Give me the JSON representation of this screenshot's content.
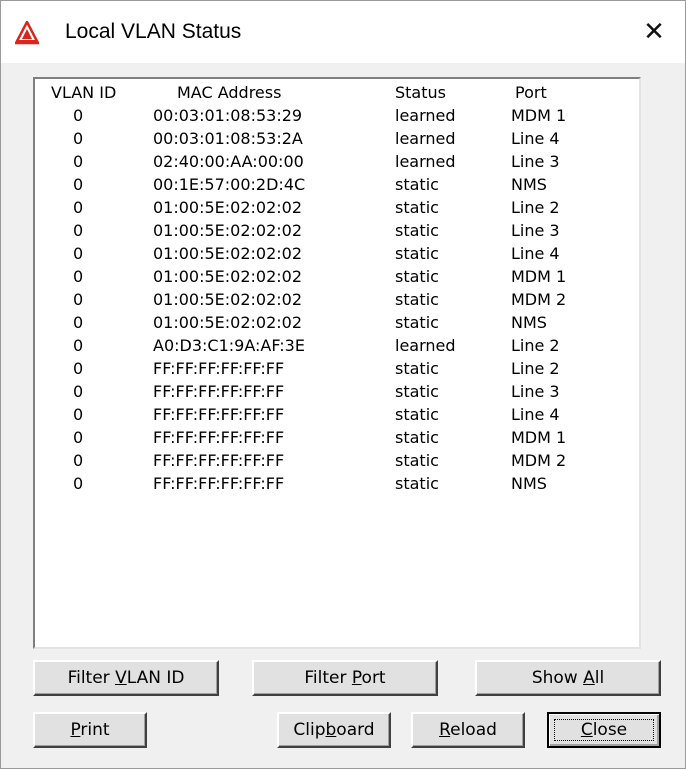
{
  "window": {
    "title": "Local VLAN Status",
    "close_glyph": "✕"
  },
  "table": {
    "headers": {
      "vlan_id": "VLAN ID",
      "mac": "MAC Address",
      "status": "Status",
      "port": "Port"
    },
    "rows": [
      {
        "vlan_id": "0",
        "mac": "00:03:01:08:53:29",
        "status": "learned",
        "port": "MDM 1"
      },
      {
        "vlan_id": "0",
        "mac": "00:03:01:08:53:2A",
        "status": "learned",
        "port": "Line 4"
      },
      {
        "vlan_id": "0",
        "mac": "02:40:00:AA:00:00",
        "status": "learned",
        "port": "Line 3"
      },
      {
        "vlan_id": "0",
        "mac": "00:1E:57:00:2D:4C",
        "status": "static",
        "port": "NMS"
      },
      {
        "vlan_id": "0",
        "mac": "01:00:5E:02:02:02",
        "status": "static",
        "port": "Line 2"
      },
      {
        "vlan_id": "0",
        "mac": "01:00:5E:02:02:02",
        "status": "static",
        "port": "Line 3"
      },
      {
        "vlan_id": "0",
        "mac": "01:00:5E:02:02:02",
        "status": "static",
        "port": "Line 4"
      },
      {
        "vlan_id": "0",
        "mac": "01:00:5E:02:02:02",
        "status": "static",
        "port": "MDM 1"
      },
      {
        "vlan_id": "0",
        "mac": "01:00:5E:02:02:02",
        "status": "static",
        "port": "MDM 2"
      },
      {
        "vlan_id": "0",
        "mac": "01:00:5E:02:02:02",
        "status": "static",
        "port": "NMS"
      },
      {
        "vlan_id": "0",
        "mac": "A0:D3:C1:9A:AF:3E",
        "status": "learned",
        "port": "Line 2"
      },
      {
        "vlan_id": "0",
        "mac": "FF:FF:FF:FF:FF:FF",
        "status": "static",
        "port": "Line 2"
      },
      {
        "vlan_id": "0",
        "mac": "FF:FF:FF:FF:FF:FF",
        "status": "static",
        "port": "Line 3"
      },
      {
        "vlan_id": "0",
        "mac": "FF:FF:FF:FF:FF:FF",
        "status": "static",
        "port": "Line 4"
      },
      {
        "vlan_id": "0",
        "mac": "FF:FF:FF:FF:FF:FF",
        "status": "static",
        "port": "MDM 1"
      },
      {
        "vlan_id": "0",
        "mac": "FF:FF:FF:FF:FF:FF",
        "status": "static",
        "port": "MDM 2"
      },
      {
        "vlan_id": "0",
        "mac": "FF:FF:FF:FF:FF:FF",
        "status": "static",
        "port": "NMS"
      }
    ]
  },
  "buttons": {
    "filter_vlan": {
      "pre": "Filter ",
      "mn": "V",
      "post": "LAN ID"
    },
    "filter_port": {
      "pre": "Filter ",
      "mn": "P",
      "post": "ort"
    },
    "show_all": {
      "pre": "Show ",
      "mn": "A",
      "post": "ll"
    },
    "print": {
      "pre": "",
      "mn": "P",
      "post": "rint"
    },
    "clipboard": {
      "pre": "Clip",
      "mn": "b",
      "post": "oard"
    },
    "reload": {
      "pre": "",
      "mn": "R",
      "post": "eload"
    },
    "close": {
      "pre": "",
      "mn": "C",
      "post": "lose"
    }
  },
  "icons": {
    "app": "warning-triangle-logo-icon",
    "close": "close-icon"
  },
  "colors": {
    "listbox_bg": "#ffffff",
    "dialog_bg": "#f0f0f0",
    "logo_red": "#d8261c"
  }
}
